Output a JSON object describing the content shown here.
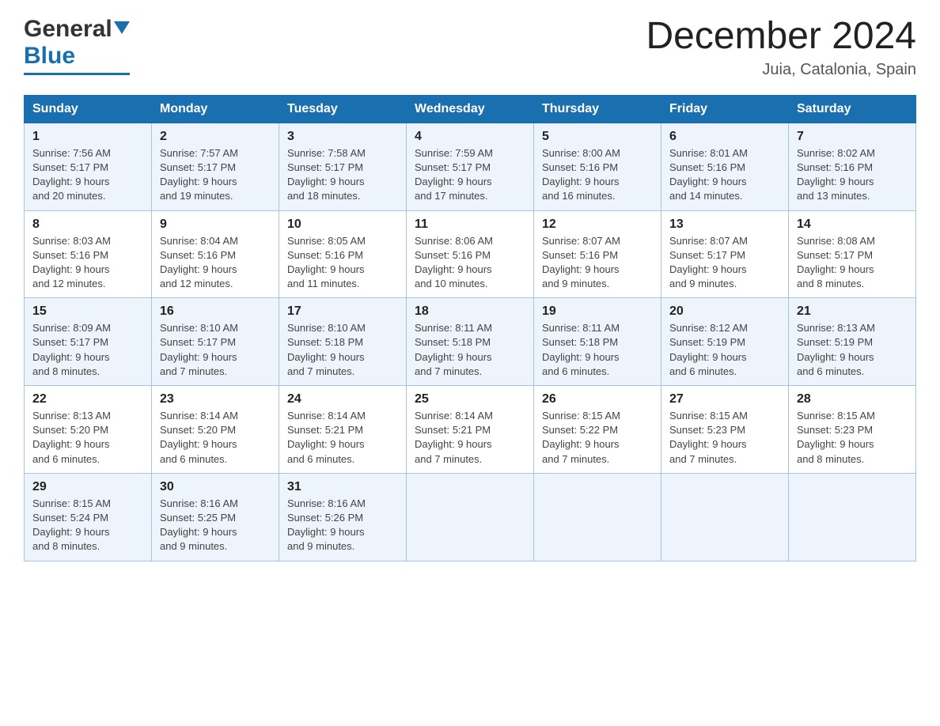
{
  "logo": {
    "general": "General",
    "blue": "Blue",
    "underline": true
  },
  "title": "December 2024",
  "subtitle": "Juia, Catalonia, Spain",
  "days_header": [
    "Sunday",
    "Monday",
    "Tuesday",
    "Wednesday",
    "Thursday",
    "Friday",
    "Saturday"
  ],
  "weeks": [
    [
      {
        "day": "1",
        "sunrise": "7:56 AM",
        "sunset": "5:17 PM",
        "daylight": "9 hours and 20 minutes."
      },
      {
        "day": "2",
        "sunrise": "7:57 AM",
        "sunset": "5:17 PM",
        "daylight": "9 hours and 19 minutes."
      },
      {
        "day": "3",
        "sunrise": "7:58 AM",
        "sunset": "5:17 PM",
        "daylight": "9 hours and 18 minutes."
      },
      {
        "day": "4",
        "sunrise": "7:59 AM",
        "sunset": "5:17 PM",
        "daylight": "9 hours and 17 minutes."
      },
      {
        "day": "5",
        "sunrise": "8:00 AM",
        "sunset": "5:16 PM",
        "daylight": "9 hours and 16 minutes."
      },
      {
        "day": "6",
        "sunrise": "8:01 AM",
        "sunset": "5:16 PM",
        "daylight": "9 hours and 14 minutes."
      },
      {
        "day": "7",
        "sunrise": "8:02 AM",
        "sunset": "5:16 PM",
        "daylight": "9 hours and 13 minutes."
      }
    ],
    [
      {
        "day": "8",
        "sunrise": "8:03 AM",
        "sunset": "5:16 PM",
        "daylight": "9 hours and 12 minutes."
      },
      {
        "day": "9",
        "sunrise": "8:04 AM",
        "sunset": "5:16 PM",
        "daylight": "9 hours and 12 minutes."
      },
      {
        "day": "10",
        "sunrise": "8:05 AM",
        "sunset": "5:16 PM",
        "daylight": "9 hours and 11 minutes."
      },
      {
        "day": "11",
        "sunrise": "8:06 AM",
        "sunset": "5:16 PM",
        "daylight": "9 hours and 10 minutes."
      },
      {
        "day": "12",
        "sunrise": "8:07 AM",
        "sunset": "5:16 PM",
        "daylight": "9 hours and 9 minutes."
      },
      {
        "day": "13",
        "sunrise": "8:07 AM",
        "sunset": "5:17 PM",
        "daylight": "9 hours and 9 minutes."
      },
      {
        "day": "14",
        "sunrise": "8:08 AM",
        "sunset": "5:17 PM",
        "daylight": "9 hours and 8 minutes."
      }
    ],
    [
      {
        "day": "15",
        "sunrise": "8:09 AM",
        "sunset": "5:17 PM",
        "daylight": "9 hours and 8 minutes."
      },
      {
        "day": "16",
        "sunrise": "8:10 AM",
        "sunset": "5:17 PM",
        "daylight": "9 hours and 7 minutes."
      },
      {
        "day": "17",
        "sunrise": "8:10 AM",
        "sunset": "5:18 PM",
        "daylight": "9 hours and 7 minutes."
      },
      {
        "day": "18",
        "sunrise": "8:11 AM",
        "sunset": "5:18 PM",
        "daylight": "9 hours and 7 minutes."
      },
      {
        "day": "19",
        "sunrise": "8:11 AM",
        "sunset": "5:18 PM",
        "daylight": "9 hours and 6 minutes."
      },
      {
        "day": "20",
        "sunrise": "8:12 AM",
        "sunset": "5:19 PM",
        "daylight": "9 hours and 6 minutes."
      },
      {
        "day": "21",
        "sunrise": "8:13 AM",
        "sunset": "5:19 PM",
        "daylight": "9 hours and 6 minutes."
      }
    ],
    [
      {
        "day": "22",
        "sunrise": "8:13 AM",
        "sunset": "5:20 PM",
        "daylight": "9 hours and 6 minutes."
      },
      {
        "day": "23",
        "sunrise": "8:14 AM",
        "sunset": "5:20 PM",
        "daylight": "9 hours and 6 minutes."
      },
      {
        "day": "24",
        "sunrise": "8:14 AM",
        "sunset": "5:21 PM",
        "daylight": "9 hours and 6 minutes."
      },
      {
        "day": "25",
        "sunrise": "8:14 AM",
        "sunset": "5:21 PM",
        "daylight": "9 hours and 7 minutes."
      },
      {
        "day": "26",
        "sunrise": "8:15 AM",
        "sunset": "5:22 PM",
        "daylight": "9 hours and 7 minutes."
      },
      {
        "day": "27",
        "sunrise": "8:15 AM",
        "sunset": "5:23 PM",
        "daylight": "9 hours and 7 minutes."
      },
      {
        "day": "28",
        "sunrise": "8:15 AM",
        "sunset": "5:23 PM",
        "daylight": "9 hours and 8 minutes."
      }
    ],
    [
      {
        "day": "29",
        "sunrise": "8:15 AM",
        "sunset": "5:24 PM",
        "daylight": "9 hours and 8 minutes."
      },
      {
        "day": "30",
        "sunrise": "8:16 AM",
        "sunset": "5:25 PM",
        "daylight": "9 hours and 9 minutes."
      },
      {
        "day": "31",
        "sunrise": "8:16 AM",
        "sunset": "5:26 PM",
        "daylight": "9 hours and 9 minutes."
      },
      null,
      null,
      null,
      null
    ]
  ],
  "labels": {
    "sunrise": "Sunrise:",
    "sunset": "Sunset:",
    "daylight": "Daylight:"
  }
}
